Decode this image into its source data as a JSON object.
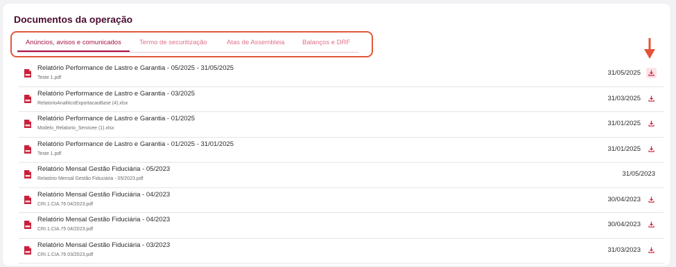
{
  "page": {
    "title": "Documentos da operação"
  },
  "tabs": [
    {
      "label": "Anúncios, avisos e comunicados",
      "active": true
    },
    {
      "label": "Termo de securitização",
      "active": false
    },
    {
      "label": "Atas de Assembleia",
      "active": false
    },
    {
      "label": "Balanços e DRF",
      "active": false
    }
  ],
  "documents": [
    {
      "title": "Relatório Performance de Lastro e Garantia - 05/2025 - 31/05/2025",
      "file": "Teste 1.pdf",
      "date": "31/05/2025",
      "icon": "pdf-file-icon",
      "download_icon": "download-icon"
    },
    {
      "title": "Relatório Performance de Lastro e Garantia - 03/2025",
      "file": "RelatorioAnaliticoExportacaoBase (4).xlsx",
      "date": "31/03/2025",
      "icon": "pdf-file-icon",
      "download_icon": "download-icon"
    },
    {
      "title": "Relatório Performance de Lastro e Garantia - 01/2025",
      "file": "Modelo_Relatorio_Servicee (1).xlsx",
      "date": "31/01/2025",
      "icon": "pdf-file-icon",
      "download_icon": "download-icon"
    },
    {
      "title": "Relatório Performance de Lastro e Garantia - 01/2025 - 31/01/2025",
      "file": "Teste 1.pdf",
      "date": "31/01/2025",
      "icon": "pdf-file-icon",
      "download_icon": "download-icon"
    },
    {
      "title": "Relatório Mensal Gestão Fiduciária - 05/2023",
      "file": "Relatório Mensal Gestão Fiduciária - 05/2023.pdf",
      "date": "31/05/2023",
      "icon": "pdf-file-icon",
      "download_icon": ""
    },
    {
      "title": "Relatório Mensal Gestão Fiduciária - 04/2023",
      "file": "CRI.1.CIA.76 04/2023.pdf",
      "date": "30/04/2023",
      "icon": "pdf-file-icon",
      "download_icon": "download-icon"
    },
    {
      "title": "Relatório Mensal Gestão Fiduciária - 04/2023",
      "file": "CRI.1.CIA.75 04/2023.pdf",
      "date": "30/04/2023",
      "icon": "pdf-file-icon",
      "download_icon": "download-icon"
    },
    {
      "title": "Relatório Mensal Gestão Fiduciária - 03/2023",
      "file": "CRI.1.CIA.76 03/2023.pdf",
      "date": "31/03/2023",
      "icon": "pdf-file-icon",
      "download_icon": "download-icon"
    }
  ],
  "colors": {
    "title": "#4a0b2e",
    "accent": "#a8134a",
    "highlight": "#e2553a",
    "icon": "#c8203a"
  }
}
